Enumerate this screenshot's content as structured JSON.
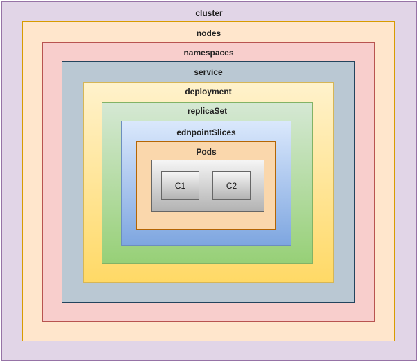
{
  "layers": {
    "cluster": {
      "label": "cluster",
      "fill": "#e1d5e7",
      "stroke": "#9673a6"
    },
    "nodes": {
      "label": "nodes",
      "fill": "#ffe6cc",
      "stroke": "#d79b00"
    },
    "namespaces": {
      "label": "namespaces",
      "fill": "#f8cecc",
      "stroke": "#b85450"
    },
    "service": {
      "label": "service",
      "fill": "#bac8d3",
      "stroke": "#23445d"
    },
    "deployment": {
      "label": "deployment",
      "fill_top": "#fff2cc",
      "fill_bottom": "#ffd966",
      "stroke": "#d6b656"
    },
    "replicaset": {
      "label": "replicaSet",
      "fill_top": "#d5e8d4",
      "fill_bottom": "#97d077",
      "stroke": "#82b366"
    },
    "endpointslices": {
      "label": "ednpointSlices",
      "fill_top": "#dae8fc",
      "fill_bottom": "#7ea6e0",
      "stroke": "#6c8ebf"
    },
    "pods": {
      "label": "Pods",
      "fill": "#fad7ac",
      "stroke": "#b46504"
    }
  },
  "containers": {
    "fill_top": "#f5f5f5",
    "fill_bottom": "#b3b3b3",
    "stroke": "#666666",
    "items": [
      {
        "label": "C1"
      },
      {
        "label": "C2"
      }
    ]
  }
}
